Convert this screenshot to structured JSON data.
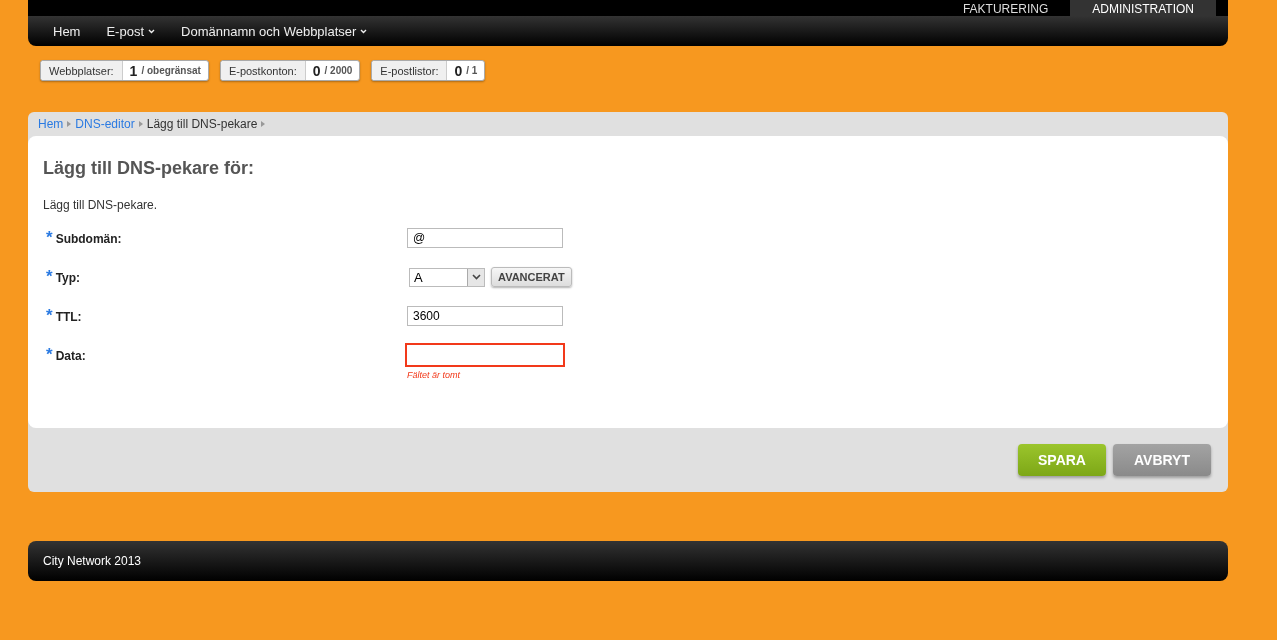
{
  "top_tabs": [
    {
      "label": "FAKTURERING",
      "selected": false
    },
    {
      "label": "ADMINISTRATION",
      "selected": true
    }
  ],
  "nav": [
    {
      "label": "Hem",
      "dropdown": false
    },
    {
      "label": "E-post",
      "dropdown": true
    },
    {
      "label": "Domännamn och Webbplatser",
      "dropdown": true
    }
  ],
  "stats": [
    {
      "label": "Webbplatser:",
      "value": "1",
      "limit": "/ obegränsat"
    },
    {
      "label": "E-postkonton:",
      "value": "0",
      "limit": "/ 2000"
    },
    {
      "label": "E-postlistor:",
      "value": "0",
      "limit": "/ 1"
    }
  ],
  "breadcrumb": [
    {
      "label": "Hem",
      "link": true
    },
    {
      "label": "DNS-editor",
      "link": true
    },
    {
      "label": "Lägg till DNS-pekare",
      "link": false
    }
  ],
  "heading": "Lägg till DNS-pekare för:",
  "intro": "Lägg till DNS-pekare.",
  "fields": [
    {
      "kind": "text",
      "required_mark": "*",
      "label": "Subdomän:",
      "value": "@",
      "invalid": false
    },
    {
      "kind": "select",
      "required_mark": "*",
      "label": "Typ:",
      "value": "A",
      "button": "AVANCERAT"
    },
    {
      "kind": "text",
      "required_mark": "*",
      "label": "TTL:",
      "value": "3600",
      "invalid": false
    },
    {
      "kind": "text",
      "required_mark": "*",
      "label": "Data:",
      "invalid": true,
      "error": "Fältet är tomt"
    }
  ],
  "buttons": [
    {
      "label": "SPARA",
      "kind": "primary"
    },
    {
      "label": "AVBRYT",
      "kind": "secondary"
    }
  ],
  "footer": "City Network 2013"
}
